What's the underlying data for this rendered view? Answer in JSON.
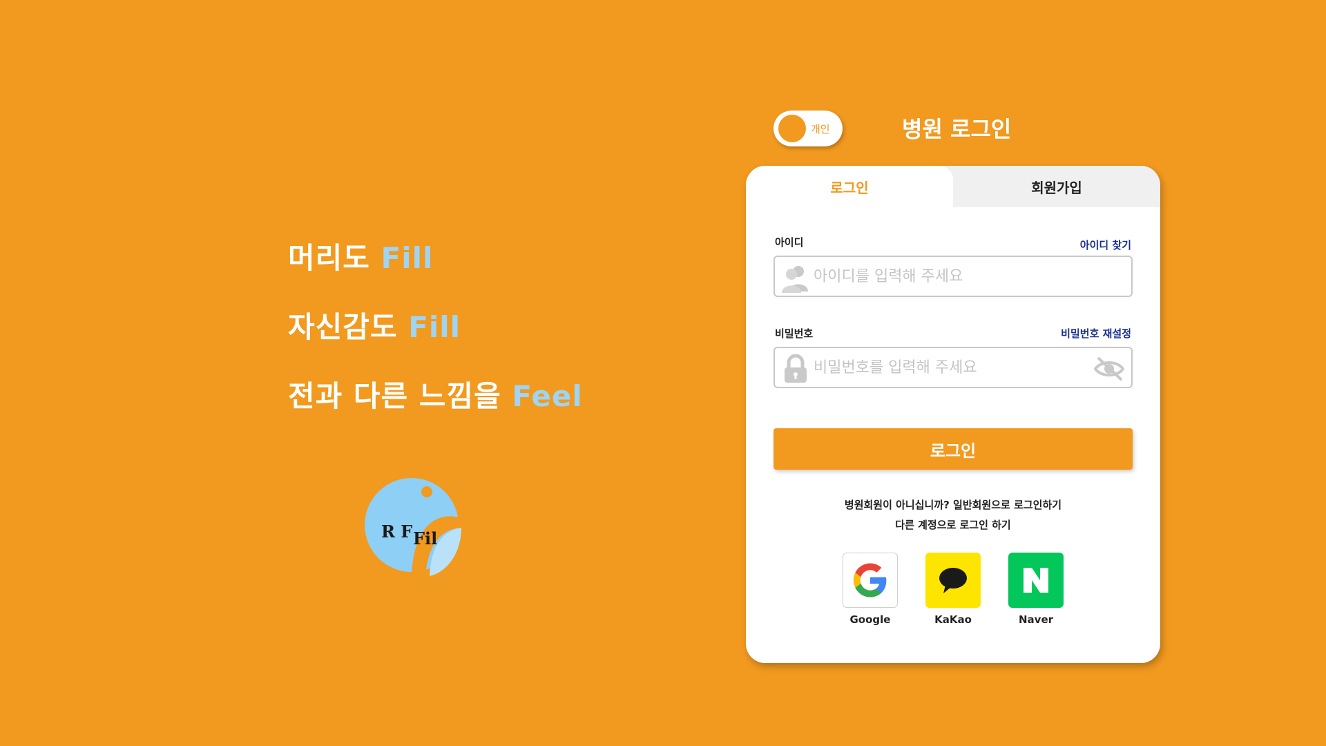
{
  "slogans": [
    {
      "text": "머리도 ",
      "accent": "Fill"
    },
    {
      "text": "자신감도 ",
      "accent": "Fill"
    },
    {
      "text": "전과 다른 느낌을 ",
      "accent": "Feel"
    }
  ],
  "logo": {
    "text_left": "R F",
    "text_right": "Fil"
  },
  "toggle": {
    "label": "개인"
  },
  "mode_title": "병원 로그인",
  "tabs": {
    "login": "로그인",
    "signup": "회원가입"
  },
  "id_field": {
    "label": "아이디",
    "link": "아이디 찾기",
    "placeholder": "아이디를 입력해 주세요"
  },
  "pw_field": {
    "label": "비밀번호",
    "link": "비밀번호 재설정",
    "placeholder": "비밀번호를 입력해 주세요"
  },
  "login_button": "로그인",
  "info": {
    "line1": "병원회원이 아니십니까? 일반회원으로 로그인하기",
    "line2": "다른 계정으로 로그인 하기"
  },
  "social": [
    {
      "name": "Google",
      "icon": "google-icon",
      "color": "#ffffff"
    },
    {
      "name": "KaKao",
      "icon": "kakao-icon",
      "color": "#fee500"
    },
    {
      "name": "Naver",
      "icon": "naver-icon",
      "color": "#03c75a"
    }
  ],
  "colors": {
    "background": "#f2991f",
    "accent_blue": "#9fd4f2",
    "link": "#1b2f8f"
  }
}
